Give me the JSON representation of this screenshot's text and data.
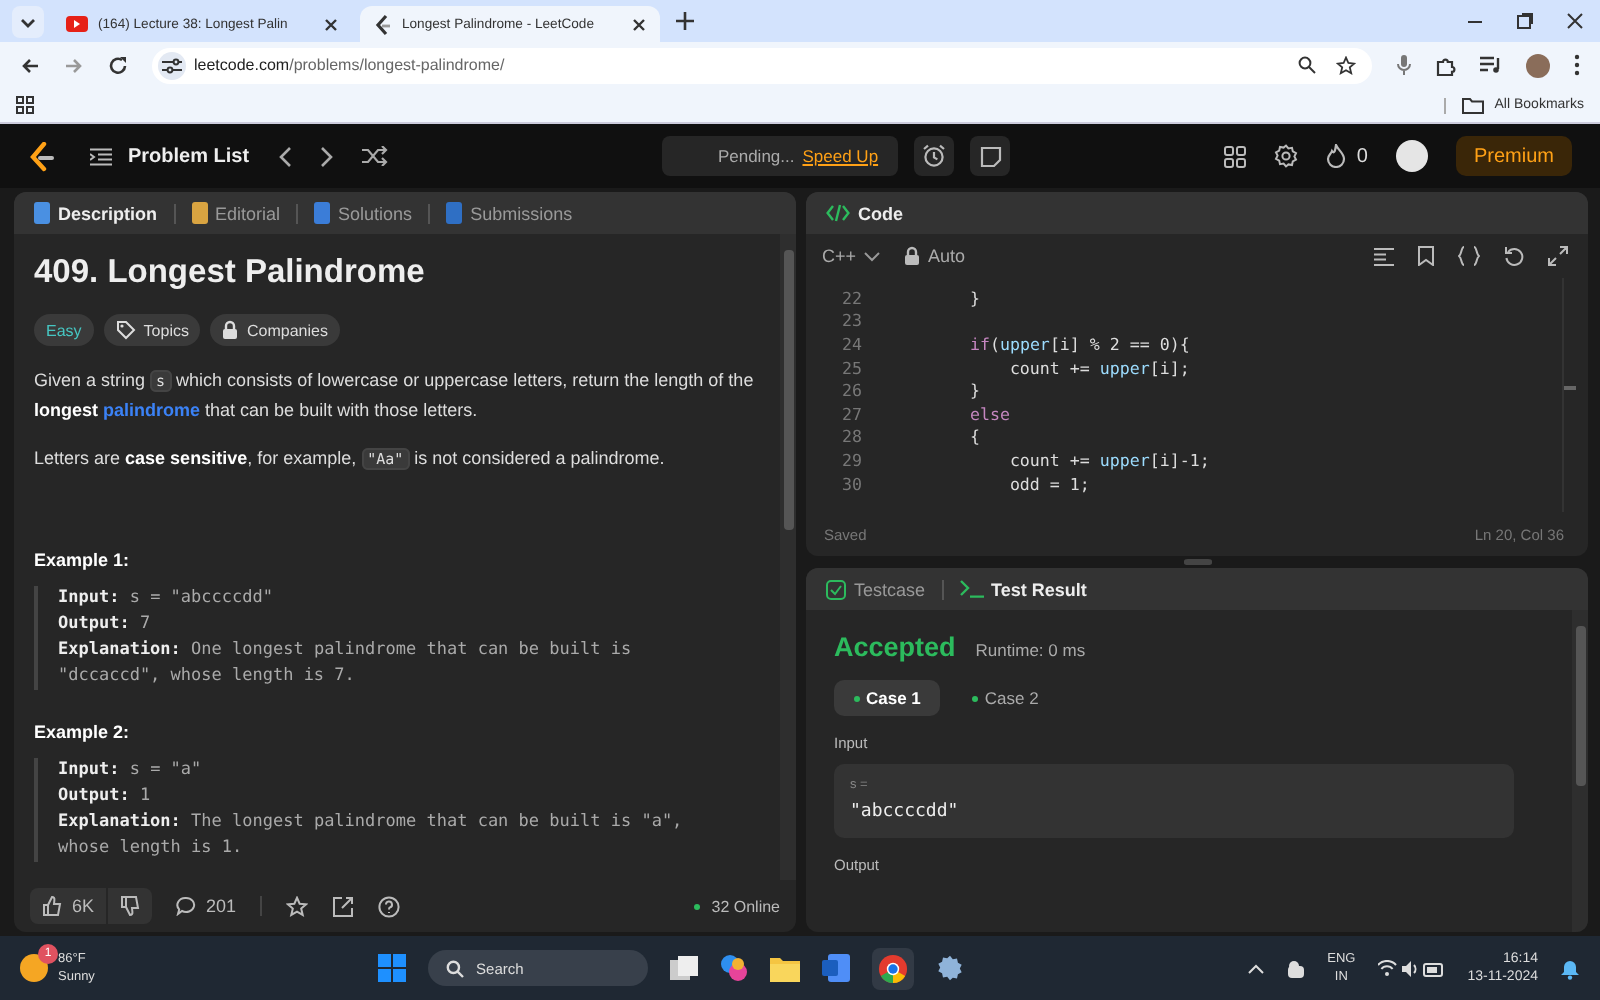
{
  "browser": {
    "tabs": [
      {
        "title": "(164) Lecture 38: Longest Palin",
        "selected": false,
        "kind": "video"
      },
      {
        "title": "Longest Palindrome - LeetCode",
        "selected": true,
        "kind": "site"
      }
    ],
    "url_host": "leetcode.com",
    "url_path": "/problems/longest-palindrome/",
    "bookmarks": "All Bookmarks"
  },
  "nav": {
    "problem_list": "Problem List",
    "pending": "Pending...",
    "speed_up": "Speed Up",
    "streak": "0",
    "premium": "Premium"
  },
  "description": {
    "tabs": [
      {
        "label": "Description",
        "selected": true,
        "color": "#4a90e2"
      },
      {
        "label": "Editorial",
        "selected": false,
        "color": "#d9a441"
      },
      {
        "label": "Solutions",
        "selected": false,
        "color": "#3b7dd8"
      },
      {
        "label": "Submissions",
        "selected": false,
        "color": "#2f6fc4"
      }
    ],
    "title": "409. Longest Palindrome",
    "difficulty": "Easy",
    "topics": "Topics",
    "companies": "Companies",
    "paragraphs": [
      [
        {
          "kind": "text",
          "text": "Given a string "
        },
        {
          "kind": "code",
          "text": "s"
        },
        {
          "kind": "text",
          "text": " which consists of lowercase or uppercase letters, return the length of the "
        },
        {
          "kind": "bold",
          "text": "longest "
        },
        {
          "kind": "link",
          "text": "palindrome"
        },
        {
          "kind": "text",
          "text": " that can be built with those letters."
        }
      ],
      [
        {
          "kind": "text",
          "text": "Letters are "
        },
        {
          "kind": "bold",
          "text": "case sensitive"
        },
        {
          "kind": "text",
          "text": ", for example, "
        },
        {
          "kind": "code",
          "text": "\"Aa\""
        },
        {
          "kind": "text",
          "text": " is not considered a palindrome."
        }
      ]
    ],
    "examples": [
      {
        "title": "Example 1:",
        "lines": [
          {
            "label": "Input:",
            "value": "s = \"abccccdd\""
          },
          {
            "label": "Output:",
            "value": "7"
          },
          {
            "label": "Explanation:",
            "value": "One longest palindrome that can be built is \"dccaccd\", whose length is 7."
          }
        ]
      },
      {
        "title": "Example 2:",
        "lines": [
          {
            "label": "Input:",
            "value": "s = \"a\""
          },
          {
            "label": "Output:",
            "value": "1"
          },
          {
            "label": "Explanation:",
            "value": "The longest palindrome that can be built is \"a\", whose length is 1."
          }
        ]
      }
    ],
    "likes": "6K",
    "comments": "201",
    "online": "32 Online"
  },
  "code": {
    "title": "Code",
    "language": "C++",
    "mode": "Auto",
    "lines": [
      {
        "num": "22",
        "tokens": [
          {
            "kind": "plain",
            "text": "        }"
          }
        ]
      },
      {
        "num": "23"
      },
      {
        "num": "24",
        "tokens": [
          {
            "kind": "kw",
            "text": "        if"
          },
          {
            "kind": "plain",
            "text": "("
          },
          {
            "kind": "var",
            "text": "upper"
          },
          {
            "kind": "plain",
            "text": "[i] % 2 == 0){"
          }
        ]
      },
      {
        "num": "25",
        "tokens": [
          {
            "kind": "plain",
            "text": "            count += "
          },
          {
            "kind": "var",
            "text": "upper"
          },
          {
            "kind": "plain",
            "text": "[i];"
          }
        ]
      },
      {
        "num": "26",
        "tokens": [
          {
            "kind": "plain",
            "text": "        }"
          }
        ]
      },
      {
        "num": "27",
        "tokens": [
          {
            "kind": "kw",
            "text": "        else"
          }
        ]
      },
      {
        "num": "28",
        "tokens": [
          {
            "kind": "plain",
            "text": "        {"
          }
        ]
      },
      {
        "num": "29",
        "tokens": [
          {
            "kind": "plain",
            "text": "            count += "
          },
          {
            "kind": "var",
            "text": "upper"
          },
          {
            "kind": "plain",
            "text": "[i]-1;"
          }
        ]
      },
      {
        "num": "30",
        "tokens": [
          {
            "kind": "plain",
            "text": "            odd = 1;"
          }
        ]
      }
    ],
    "saved": "Saved",
    "position": "Ln 20, Col 36"
  },
  "result": {
    "tabs": [
      {
        "label": "Testcase",
        "selected": false
      },
      {
        "label": "Test Result",
        "selected": true
      }
    ],
    "status": "Accepted",
    "runtime": "Runtime: 0 ms",
    "cases": [
      {
        "label": "Case 1",
        "selected": true
      },
      {
        "label": "Case 2",
        "selected": false
      }
    ],
    "input_label": "Input",
    "var": "s =",
    "value": "\"abccccdd\"",
    "output_label": "Output"
  },
  "taskbar": {
    "temperature": "86°F",
    "weather": "Sunny",
    "badge": "1",
    "search": "Search",
    "lang": "ENG",
    "region": "IN",
    "time": "16:14",
    "date": "13-11-2024"
  }
}
